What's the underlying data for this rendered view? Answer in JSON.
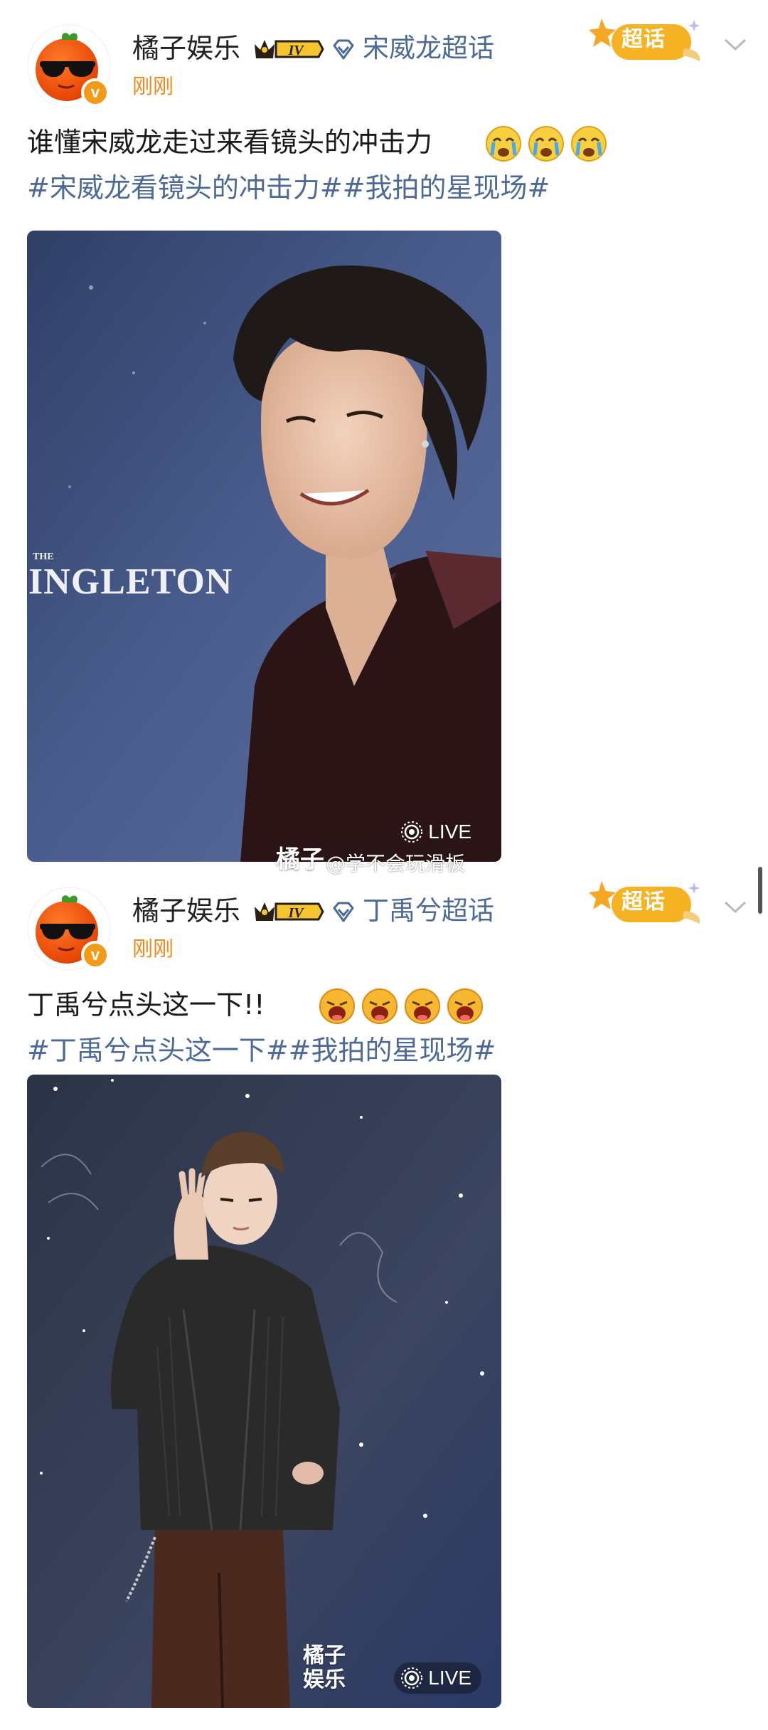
{
  "posts": [
    {
      "author": "橘子娱乐",
      "vip_level": "IV",
      "topic": "宋威龙超话",
      "chaohua_label": "超话",
      "time": "刚刚",
      "text": "谁懂宋威龙走过来看镜头的冲击力",
      "emoji_icons": [
        "crying-emoji-icon",
        "crying-emoji-icon",
        "crying-emoji-icon"
      ],
      "tags": "#宋威龙看镜头的冲击力##我拍的星现场#",
      "photo_caption": "INGLETON",
      "photo_badge": "LIVE",
      "watermark_brand": "橘子",
      "watermark_user": "@学不会玩滑板"
    },
    {
      "author": "橘子娱乐",
      "vip_level": "IV",
      "topic": "丁禹兮超话",
      "chaohua_label": "超话",
      "time": "刚刚",
      "text": "丁禹兮点头这一下!!",
      "emoji_icons": [
        "screaming-emoji-icon",
        "screaming-emoji-icon",
        "screaming-emoji-icon",
        "screaming-emoji-icon"
      ],
      "tags": "#丁禹兮点头这一下##我拍的星现场#",
      "photo_badge": "LIVE",
      "watermark_brand_line1": "橘子",
      "watermark_brand_line2": "娱乐"
    }
  ],
  "colors": {
    "link": "#4d6a97",
    "time": "#f08a1a",
    "verified": "#f29b16",
    "chaohua_badge": "#f5b324"
  }
}
